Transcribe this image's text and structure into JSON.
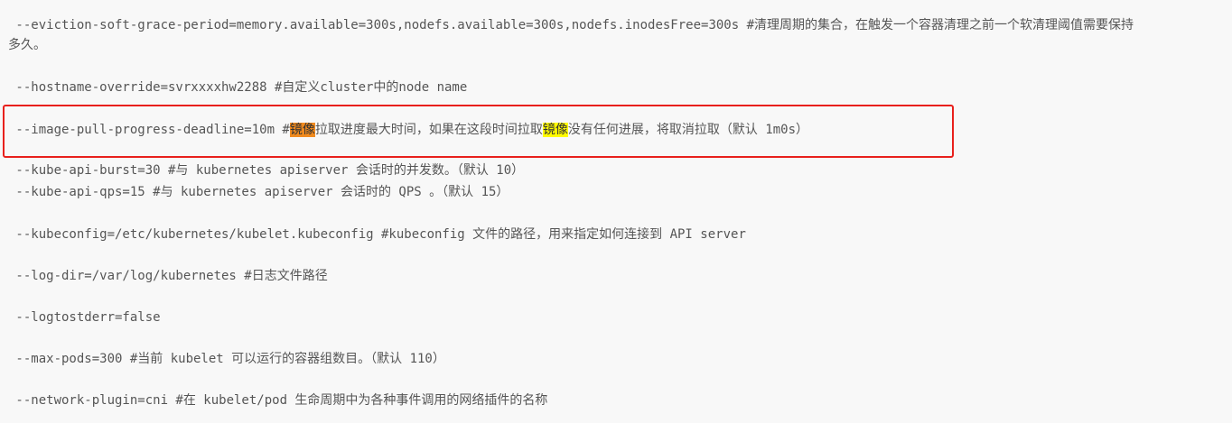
{
  "lines": {
    "eviction_1": " --eviction-soft-grace-period=memory.available=300s,nodefs.available=300s,nodefs.inodesFree=300s #清理周期的集合，在触发一个容器清理之前一个软清理阈值需要保持",
    "eviction_2": "多久。",
    "hostname": " --hostname-override=svrxxxxhw2288 #自定义cluster中的node name",
    "image_pull": {
      "part1": " --image-pull-progress-deadline=10m #",
      "hl1": "镜像",
      "part2": "拉取进度最大时间，如果在这段时间拉取",
      "hl2": "镜像",
      "part3": "没有任何进展，将取消拉取（默认 1m0s）"
    },
    "api_burst": " --kube-api-burst=30 #与 kubernetes apiserver 会话时的并发数。（默认 10）",
    "api_qps": " --kube-api-qps=15 #与 kubernetes apiserver 会话时的 QPS 。（默认 15）",
    "kubeconfig": " --kubeconfig=/etc/kubernetes/kubelet.kubeconfig #kubeconfig 文件的路径，用来指定如何连接到 API server",
    "log_dir": " --log-dir=/var/log/kubernetes #日志文件路径",
    "logtostderr": " --logtostderr=false",
    "max_pods": " --max-pods=300 #当前 kubelet 可以运行的容器组数目。（默认 110）",
    "network_plugin": " --network-plugin=cni #在 kubelet/pod 生命周期中为各种事件调用的网络插件的名称"
  },
  "colors": {
    "background": "#f8f8f8",
    "text": "#555555",
    "highlight_orange": "#f08a1e",
    "highlight_yellow": "#fffb00",
    "box_border": "#e8201c"
  }
}
